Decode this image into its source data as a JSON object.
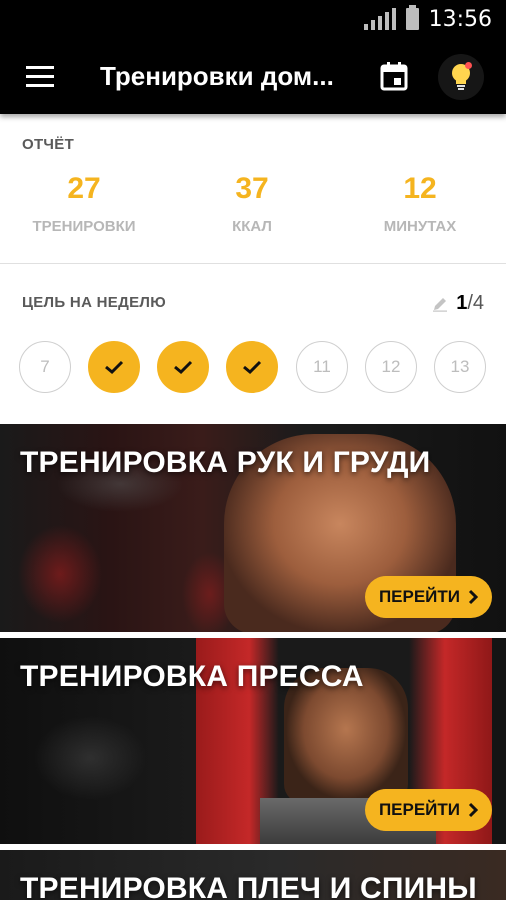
{
  "status_bar": {
    "time": "13:56"
  },
  "app_bar": {
    "title": "Тренировки дом..."
  },
  "report": {
    "label": "ОТЧЁТ",
    "stats": [
      {
        "value": "27",
        "label": "ТРЕНИРОВКИ"
      },
      {
        "value": "37",
        "label": "ККАЛ"
      },
      {
        "value": "12",
        "label": "МИНУТАХ"
      }
    ]
  },
  "weekly_goal": {
    "label": "ЦЕЛЬ НА НЕДЕЛЮ",
    "current": "1",
    "total": "/4",
    "days": [
      {
        "label": "7",
        "done": false
      },
      {
        "label": "",
        "done": true
      },
      {
        "label": "",
        "done": true
      },
      {
        "label": "",
        "done": true
      },
      {
        "label": "11",
        "done": false
      },
      {
        "label": "12",
        "done": false
      },
      {
        "label": "13",
        "done": false
      }
    ]
  },
  "workouts": [
    {
      "title": "ТРЕНИРОВКА РУК И ГРУДИ",
      "button": "ПЕРЕЙТИ"
    },
    {
      "title": "ТРЕНИРОВКА ПРЕССА",
      "button": "ПЕРЕЙТИ"
    },
    {
      "title": "ТРЕНИРОВКА ПЛЕЧ И СПИНЫ"
    }
  ],
  "colors": {
    "accent": "#f5b41f",
    "bar": "#000000"
  }
}
